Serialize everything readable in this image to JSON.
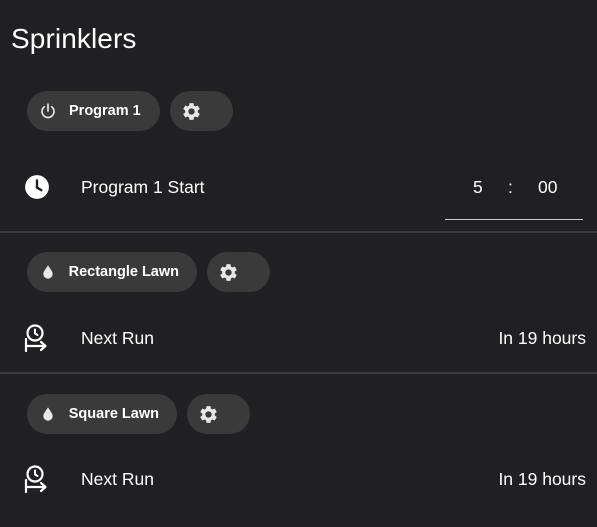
{
  "card": {
    "title": "Sprinklers"
  },
  "program": {
    "chip_label": "Program 1",
    "chip_icon": "power-icon",
    "settings_icon": "gear-icon",
    "start_label": "Program 1 Start",
    "start_icon": "clock-icon",
    "start_time": {
      "hour": "5",
      "separator": ":",
      "minute": "00"
    }
  },
  "zones": [
    {
      "chip_label": "Rectangle Lawn",
      "chip_icon": "water-drop-icon",
      "settings_icon": "gear-icon",
      "next_run_label": "Next Run",
      "next_run_icon": "timer-arrow-icon",
      "next_run_value": "In 19 hours"
    },
    {
      "chip_label": "Square Lawn",
      "chip_icon": "water-drop-icon",
      "settings_icon": "gear-icon",
      "next_run_label": "Next Run",
      "next_run_icon": "timer-arrow-icon",
      "next_run_value": "In 19 hours"
    }
  ],
  "colors": {
    "background": "#201f21",
    "chip": "#3a3a3a",
    "divider": "#3b3b3b",
    "text": "#ffffff"
  }
}
